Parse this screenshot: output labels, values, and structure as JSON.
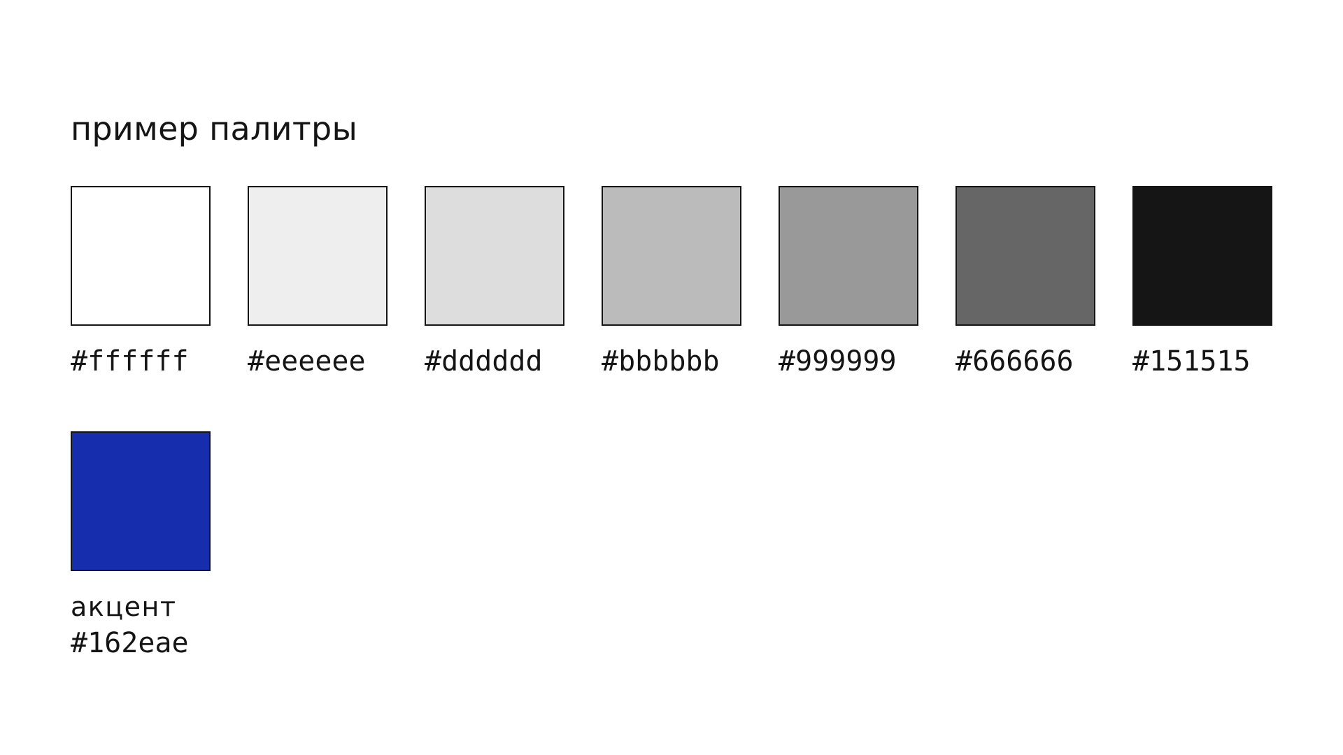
{
  "title": "пример палитры",
  "swatches": [
    {
      "hex": "#ffffff",
      "label": "#ffffff"
    },
    {
      "hex": "#eeeeee",
      "label": "#eeeeee"
    },
    {
      "hex": "#dddddd",
      "label": "#dddddd"
    },
    {
      "hex": "#bbbbbb",
      "label": "#bbbbbb"
    },
    {
      "hex": "#999999",
      "label": "#999999"
    },
    {
      "hex": "#666666",
      "label": "#666666"
    },
    {
      "hex": "#151515",
      "label": "#151515"
    }
  ],
  "accent": {
    "name": "акцент",
    "hex": "#162eae",
    "label": "#162eae"
  }
}
